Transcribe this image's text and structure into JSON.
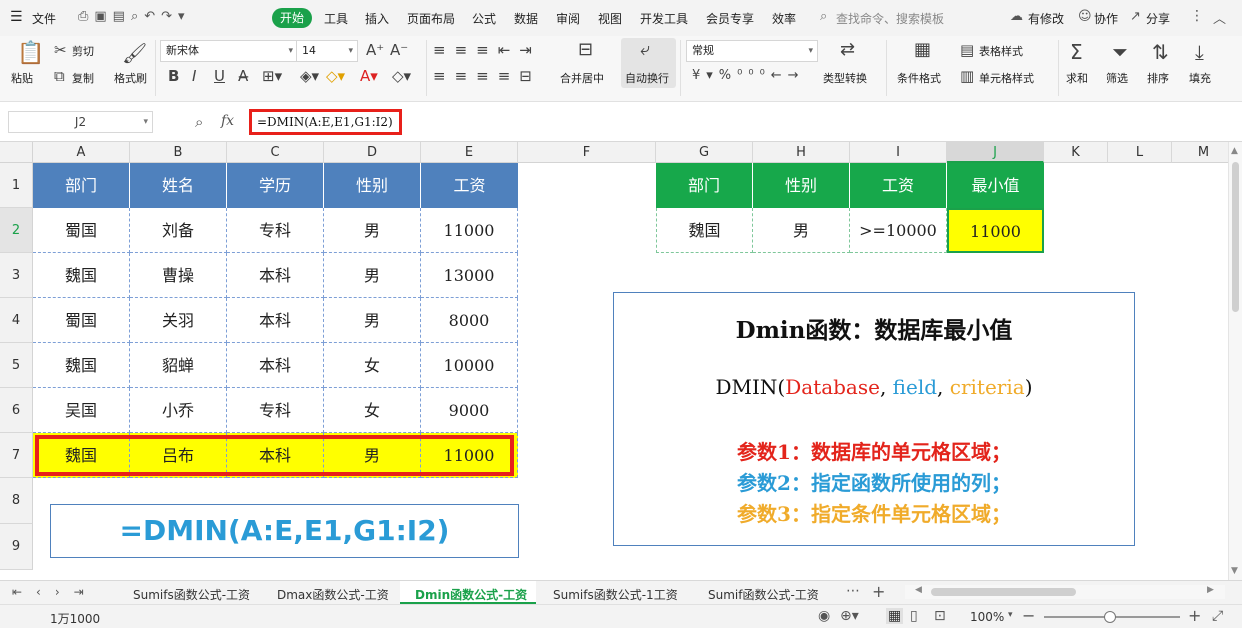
{
  "menubar": {
    "file_label": "文件",
    "tabs": [
      "开始",
      "工具",
      "插入",
      "页面布局",
      "公式",
      "数据",
      "审阅",
      "视图",
      "开发工具",
      "会员专享",
      "效率"
    ],
    "search_placeholder": "查找命令、搜索模板",
    "modified_label": "有修改",
    "collab_label": "协作",
    "share_label": "分享"
  },
  "ribbon": {
    "paste": "粘贴",
    "cut": "剪切",
    "copy": "复制",
    "format_painter": "格式刷",
    "font_name": "新宋体",
    "font_size": "14",
    "merge_center": "合并居中",
    "wrap_text": "自动换行",
    "number_format": "常规",
    "type_convert": "类型转换",
    "cond_format": "条件格式",
    "table_style": "表格样式",
    "cell_style": "单元格样式",
    "sum": "求和",
    "filter": "筛选",
    "sort": "排序",
    "fill": "填充"
  },
  "formula_bar": {
    "name_box": "J2",
    "fx": "fx",
    "formula": "=DMIN(A:E,E1,G1:I2)"
  },
  "columns": [
    "A",
    "B",
    "C",
    "D",
    "E",
    "F",
    "G",
    "H",
    "I",
    "J",
    "K",
    "L",
    "M"
  ],
  "rows": [
    "1",
    "2",
    "3",
    "4",
    "5",
    "6",
    "7",
    "8",
    "9"
  ],
  "table": {
    "headers": [
      "部门",
      "姓名",
      "学历",
      "性别",
      "工资"
    ],
    "rows": [
      [
        "蜀国",
        "刘备",
        "专科",
        "男",
        "11000"
      ],
      [
        "魏国",
        "曹操",
        "本科",
        "男",
        "13000"
      ],
      [
        "蜀国",
        "关羽",
        "本科",
        "男",
        "8000"
      ],
      [
        "魏国",
        "貂蝉",
        "本科",
        "女",
        "10000"
      ],
      [
        "吴国",
        "小乔",
        "专科",
        "女",
        "9000"
      ],
      [
        "魏国",
        "吕布",
        "本科",
        "男",
        "11000"
      ]
    ]
  },
  "criteria": {
    "headers": [
      "部门",
      "性别",
      "工资",
      "最小值"
    ],
    "values": [
      "魏国",
      "男",
      ">=10000",
      "11000"
    ]
  },
  "formula_box": "=DMIN(A:E,E1,G1:I2)",
  "info": {
    "title": "Dmin函数：数据库最小值",
    "syntax_fn": "DMIN(",
    "syntax_a1": "Database",
    "syntax_sep1": ",",
    "syntax_a2": "field",
    "syntax_sep2": ",",
    "syntax_a3": "criteria",
    "syntax_end": ")",
    "param1": "参数1：数据库的单元格区域；",
    "param2": "参数2：指定函数所使用的列；",
    "param3": "参数3：指定条件单元格区域；"
  },
  "sheets": [
    "Sumifs函数公式-工资",
    "Dmax函数公式-工资",
    "Dmin函数公式-工资",
    "Sumifs函数公式-1工资",
    "Sumif函数公式-工资"
  ],
  "active_sheet": "Dmin函数公式-工资",
  "status": {
    "sum_value": "1万1000",
    "zoom": "100%"
  },
  "colors": {
    "accent": "#1aa14a",
    "header_blue": "#4f81bd",
    "header_green": "#17a84b",
    "highlight": "#ffff00",
    "red_box": "#e8201a",
    "param1": "#e3241b",
    "param2": "#2a9bd6",
    "param3": "#f0ab2a"
  }
}
